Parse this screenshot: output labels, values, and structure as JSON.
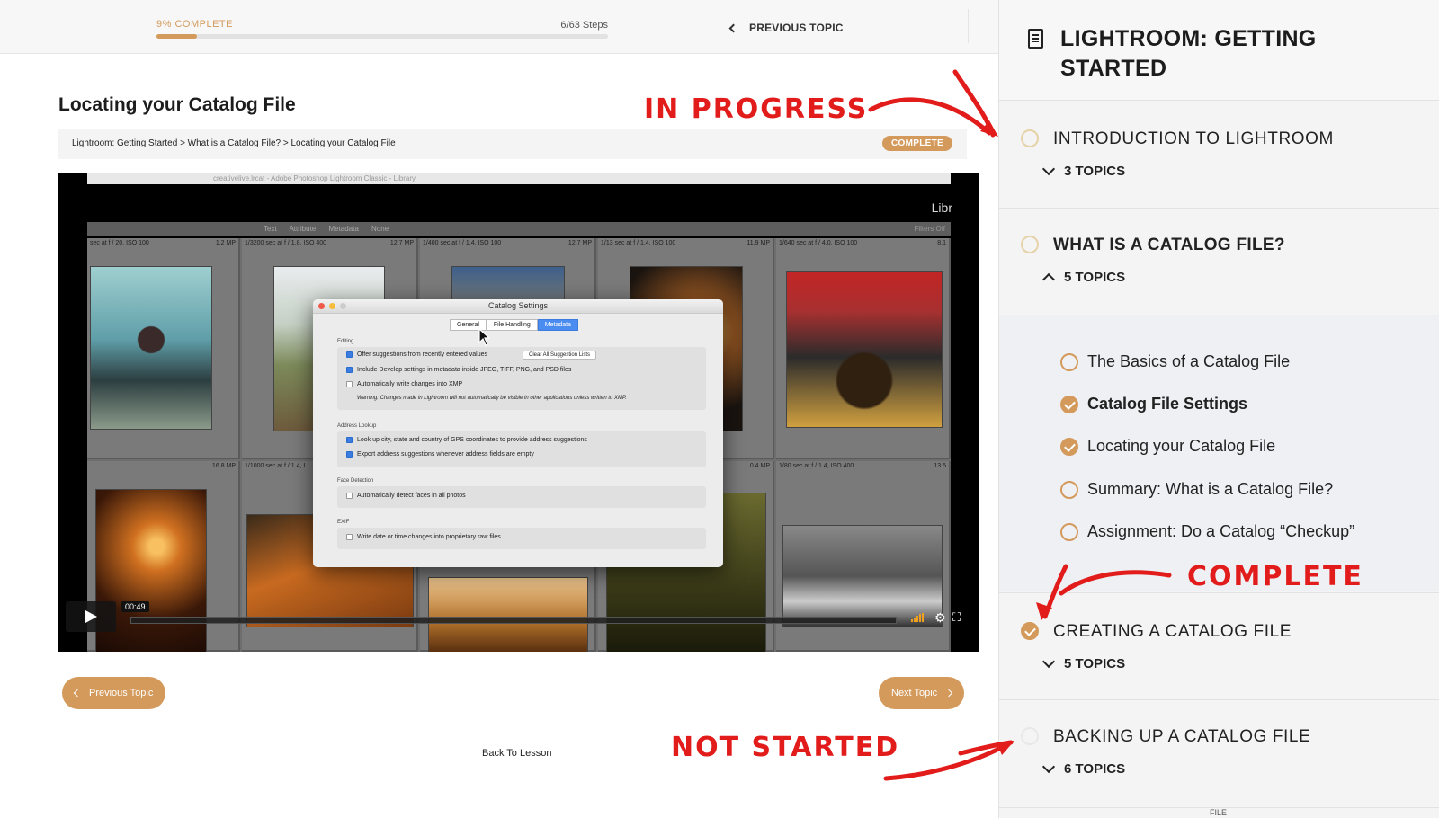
{
  "progress": {
    "label": "9% COMPLETE",
    "percent": 9,
    "steps": "6/63 Steps"
  },
  "top_nav": {
    "previous_topic": "PREVIOUS TOPIC"
  },
  "lesson": {
    "title": "Locating your Catalog File",
    "breadcrumb": "Lightroom: Getting Started > What is a Catalog File? > Locating your Catalog File",
    "status_badge": "COMPLETE"
  },
  "video": {
    "window_title": "creativelive.lrcat - Adobe Photoshop Lightroom Classic - Library",
    "brand": "Libr",
    "filter_bar": "Text Attribute Metadata None",
    "filter_right": "Filters Off",
    "cells": [
      {
        "meta_left": "sec at f / 20, ISO 100",
        "meta_right": "1.2 MP"
      },
      {
        "meta_left": "1/3200 sec at f / 1.8, ISO 400",
        "meta_right": "12.7 MP"
      },
      {
        "meta_left": "1/400 sec at f / 1.4, ISO 100",
        "meta_right": "12.7 MP"
      },
      {
        "meta_left": "1/13 sec at f / 1.4, ISO 100",
        "meta_right": "11.9 MP"
      },
      {
        "meta_left": "1/640 sec at f / 4.0, ISO 100",
        "meta_right": "8.1"
      },
      {
        "meta_left": "",
        "meta_right": "16.8 MP"
      },
      {
        "meta_left": "1/1000 sec at f / 1.4, I",
        "meta_right": ""
      },
      {
        "meta_left": "",
        "meta_right": ""
      },
      {
        "meta_left": "",
        "meta_right": "0.4 MP"
      },
      {
        "meta_left": "1/80 sec at f / 1.4, ISO 400",
        "meta_right": "13.5"
      }
    ],
    "dialog": {
      "title": "Catalog Settings",
      "tabs": [
        "General",
        "File Handling",
        "Metadata"
      ],
      "active_tab": "Metadata",
      "editing_label": "Editing",
      "opt_suggestions": "Offer suggestions from recently entered values",
      "clear_button": "Clear All Suggestion Lists",
      "opt_develop": "Include Develop settings in metadata inside JPEG, TIFF, PNG, and PSD files",
      "opt_xmp": "Automatically write changes into XMP",
      "warning": "Warning: Changes made in Lightroom will not automatically be visible in other applications unless written to XMP.",
      "address_label": "Address Lookup",
      "opt_gps": "Look up city, state and country of GPS coordinates to provide address suggestions",
      "opt_export": "Export address suggestions whenever address fields are empty",
      "face_label": "Face Detection",
      "opt_faces": "Automatically detect faces in all photos",
      "exif_label": "EXIF",
      "opt_exif": "Write date or time changes into proprietary raw files."
    },
    "time": "00:49"
  },
  "bottom_nav": {
    "previous": "Previous Topic",
    "next": "Next Topic",
    "back": "Back To Lesson"
  },
  "sidebar": {
    "title": "LIGHTROOM: GETTING STARTED",
    "sections": [
      {
        "title": "INTRODUCTION TO LIGHTROOM",
        "topics": "3 TOPICS"
      },
      {
        "title": "WHAT IS A CATALOG FILE?",
        "topics": "5 TOPICS"
      },
      {
        "title": "CREATING A CATALOG FILE",
        "topics": "5 TOPICS"
      },
      {
        "title": "BACKING UP A CATALOG FILE",
        "topics": "6 TOPICS"
      }
    ],
    "topic_items": [
      "The Basics of a Catalog File",
      "Catalog File Settings",
      "Locating your Catalog File",
      "Summary: What is a Catalog File?",
      "Assignment: Do a Catalog “Checkup”"
    ],
    "footer_text": "FILE"
  },
  "annotations": {
    "in_progress": "IN PROGRESS",
    "complete": "COMPLETE",
    "not_started": "NOT STARTED"
  },
  "colors": {
    "accent": "#d49a5c",
    "annotation": "#e21b1b"
  }
}
